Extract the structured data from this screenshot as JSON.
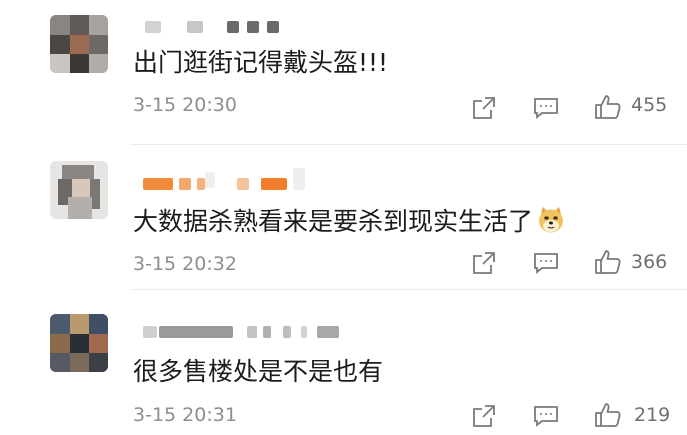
{
  "comments": [
    {
      "text": "出门逛街记得戴头盔!!!",
      "time": "3-15 20:30",
      "likes": "455"
    },
    {
      "text": "大数据杀熟看来是要杀到现实生活了",
      "emoji": "doge-emoji",
      "time": "3-15 20:32",
      "likes": "366"
    },
    {
      "text": "很多售楼处是不是也有",
      "time": "3-15 20:31",
      "likes": "219"
    }
  ],
  "icons": {
    "share": "share-icon",
    "reply": "comment-icon",
    "like": "thumbs-up-icon"
  },
  "colors": {
    "text": "#1c1c1c",
    "meta": "#8e8e8e",
    "icon": "#7a7a7a",
    "username_orange": "#f28b3c"
  }
}
